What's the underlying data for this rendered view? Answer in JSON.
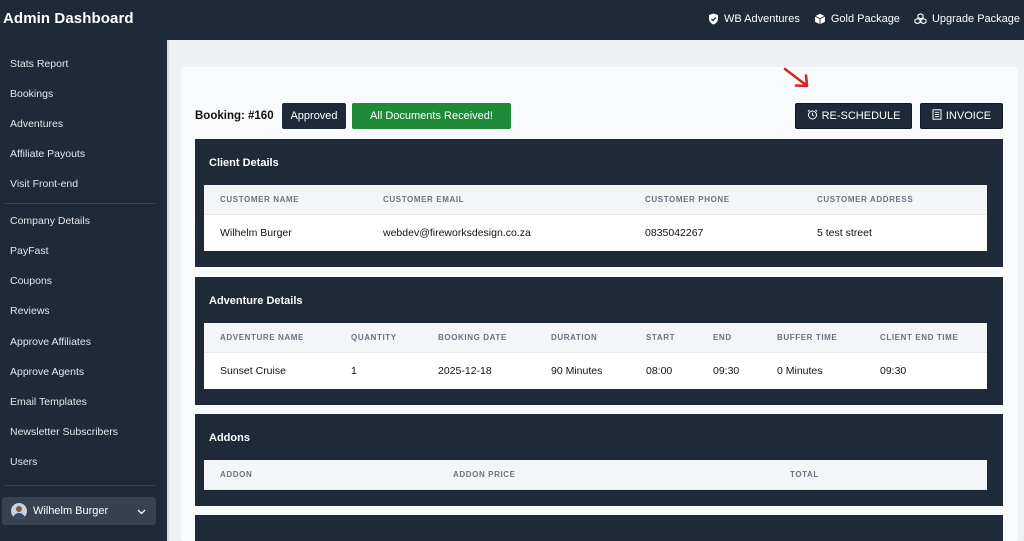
{
  "brand": "Admin Dashboard",
  "topnav": [
    {
      "icon": "shield-icon",
      "label": "WB Adventures"
    },
    {
      "icon": "box-icon",
      "label": "Gold Package"
    },
    {
      "icon": "stack-icon",
      "label": "Upgrade Package"
    }
  ],
  "sidebar": {
    "group1": [
      "Stats Report",
      "Bookings",
      "Adventures",
      "Affiliate Payouts",
      "Visit Front-end"
    ],
    "group2": [
      "Company Details",
      "PayFast",
      "Coupons",
      "Reviews",
      "Approve Affiliates",
      "Approve Agents",
      "Email Templates",
      "Newsletter Subscribers",
      "Users"
    ],
    "user": "Wilhelm Burger"
  },
  "booking": {
    "label": "Booking: #160",
    "status": "Approved",
    "documents": "All Documents Received!",
    "reschedule": "RE-SCHEDULE",
    "invoice": "INVOICE"
  },
  "client": {
    "title": "Client Details",
    "headers": [
      "Customer Name",
      "Customer Email",
      "Customer Phone",
      "Customer Address"
    ],
    "row": [
      "Wilhelm Burger",
      "webdev@fireworksdesign.co.za",
      "0835042267",
      "5 test street"
    ]
  },
  "adventure": {
    "title": "Adventure Details",
    "headers": [
      "Adventure Name",
      "Quantity",
      "Booking Date",
      "Duration",
      "Start",
      "End",
      "Buffer Time",
      "Client End Time"
    ],
    "row": [
      "Sunset Cruise",
      "1",
      "2025-12-18",
      "90 Minutes",
      "08:00",
      "09:30",
      "0 Minutes",
      "09:30"
    ]
  },
  "addons": {
    "title": "Addons",
    "headers": [
      "Addon",
      "Addon Price",
      "Total"
    ]
  },
  "colors": {
    "dark": "#1f2937",
    "success": "#1e8a3a",
    "arrow": "#d7261e"
  }
}
